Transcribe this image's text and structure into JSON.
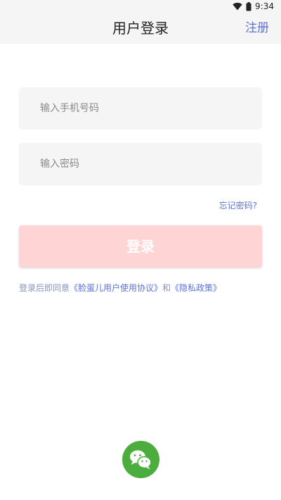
{
  "status_bar": {
    "time": "9:34",
    "icons": [
      "wifi-icon",
      "battery-icon"
    ]
  },
  "header": {
    "title": "用户登录",
    "action_label": "注册"
  },
  "form": {
    "phone_placeholder": "输入手机号码",
    "phone_value": "",
    "password_placeholder": "输入密码",
    "password_value": "",
    "forgot_label": "忘记密码?",
    "login_label": "登录"
  },
  "agreement": {
    "prefix": "登录后即同意",
    "terms_link": "《脸蛋儿用户使用协议》",
    "conjunction": "和",
    "privacy_link": "《隐私政策》"
  },
  "social_login": {
    "icon": "wechat-icon"
  },
  "colors": {
    "accent": "#5b72d6",
    "login_button": "#ffd4d4",
    "wechat": "#4bad3d",
    "field_bg": "#f5f5f5"
  }
}
